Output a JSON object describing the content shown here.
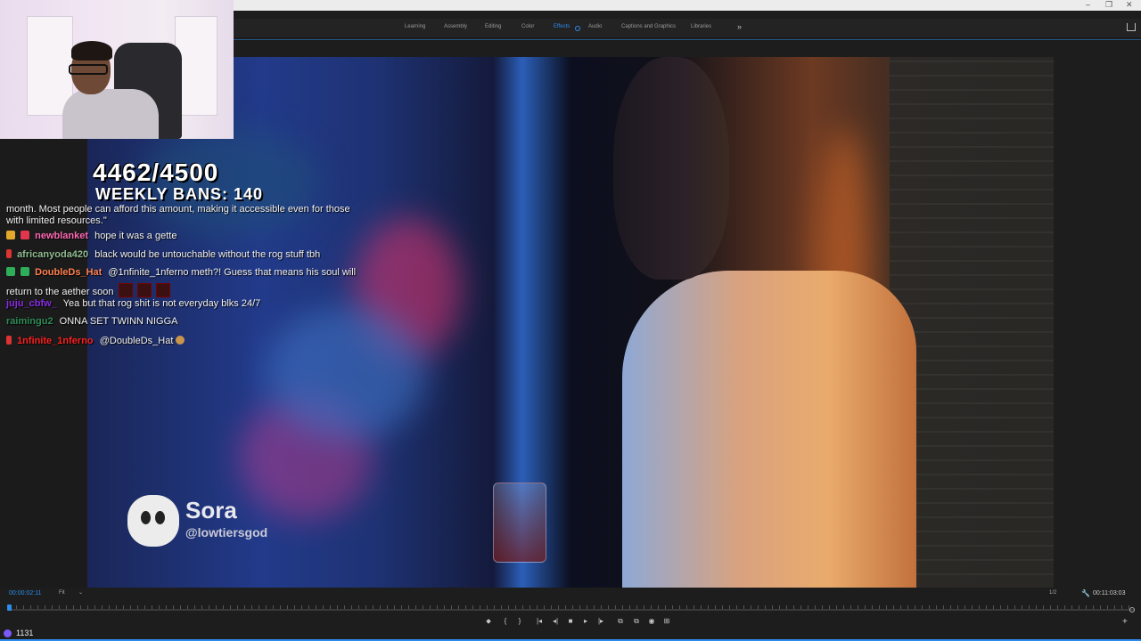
{
  "window": {
    "minimize": "–",
    "maximize": "❐",
    "close": "✕"
  },
  "workspaces": [
    "Learning",
    "Assembly",
    "Editing",
    "Color",
    "Effects",
    "Audio",
    "Captions and Graphics",
    "Libraries"
  ],
  "active_workspace": "Effects",
  "overlay": {
    "counter": "4462/4500",
    "weekly_bans": "WEEKLY BANS: 140"
  },
  "video": {
    "watermark_name": "Sora",
    "watermark_handle": "@lowtiersgod"
  },
  "chat": [
    {
      "user": "",
      "color": "#ffffff",
      "text": "month. Most people can afford this amount, making it accessible even for those"
    },
    {
      "user": "",
      "color": "#ffffff",
      "text": "with limited resources.\""
    },
    {
      "user": "newblanket",
      "color": "#ff69b4",
      "text": "hope it was a gette"
    },
    {
      "user": "africanyoda420",
      "color": "#8fbc8f",
      "text": "black would be untouchable without the rog stuff tbh"
    },
    {
      "user": "DoubleDs_Hat",
      "color": "#ff7f50",
      "text": "@1nfinite_1nferno meth?! Guess that means his soul will"
    },
    {
      "user": "",
      "color": "#ffffff",
      "text": "return to the aether soon"
    },
    {
      "user": "juju_cbfw_",
      "color": "#8a2be2",
      "text": "Yea but that rog shit is not everyday blks 24/7"
    },
    {
      "user": "raimingu2",
      "color": "#2e8b57",
      "text": "ONNA SET TWINN NIGGA"
    },
    {
      "user": "1nfinite_1nferno",
      "color": "#ff2020",
      "text": "@DoubleDs_Hat"
    }
  ],
  "controls": {
    "timecode_current": "00:00:02:11",
    "fit": "Fit",
    "fit_caret": "⌄",
    "fraction": "1/2",
    "timecode_total": "00:11:03:03",
    "buttons": [
      "⬥",
      "{",
      "}",
      "|◂",
      "◂|",
      "■",
      "▸",
      "|▸",
      "⧉",
      "⧉",
      "◉",
      "⊞"
    ],
    "add": "+"
  },
  "stream": {
    "viewers": "1131"
  },
  "colors": {
    "accent": "#2d8ceb"
  }
}
